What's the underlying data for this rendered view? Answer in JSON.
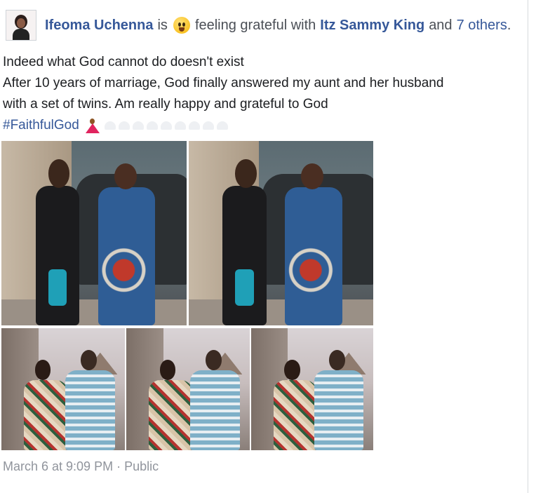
{
  "post": {
    "author": "Ifeoma Uchenna",
    "verb": "is",
    "feeling_emoji": "smiling-face-icon",
    "feeling_text": "feeling grateful with",
    "tagged": "Itz Sammy King",
    "and_text": "and",
    "others_link": "7 others",
    "period": ".",
    "lines": [
      "Indeed what God cannot do doesn't exist",
      "After 10 years of marriage, God finally answered my aunt and her husband",
      "with a set of twins. Am really happy and grateful to God"
    ],
    "hashtag": "#FaithfulGod",
    "hashtag_emoji": "dancing-woman-icon",
    "timestamp": "March 6 at 9:09 PM",
    "separator": "·",
    "privacy": "Public"
  },
  "photos": [
    {
      "alt": "two women standing in front of a car"
    },
    {
      "alt": "two women standing in front of a car"
    },
    {
      "alt": "girl and boy posing outdoors"
    },
    {
      "alt": "girl and boy posing outdoors"
    },
    {
      "alt": "girl and boy posing outdoors"
    }
  ],
  "colors": {
    "link": "#365899",
    "meta": "#90949c",
    "text": "#1c1e21"
  }
}
